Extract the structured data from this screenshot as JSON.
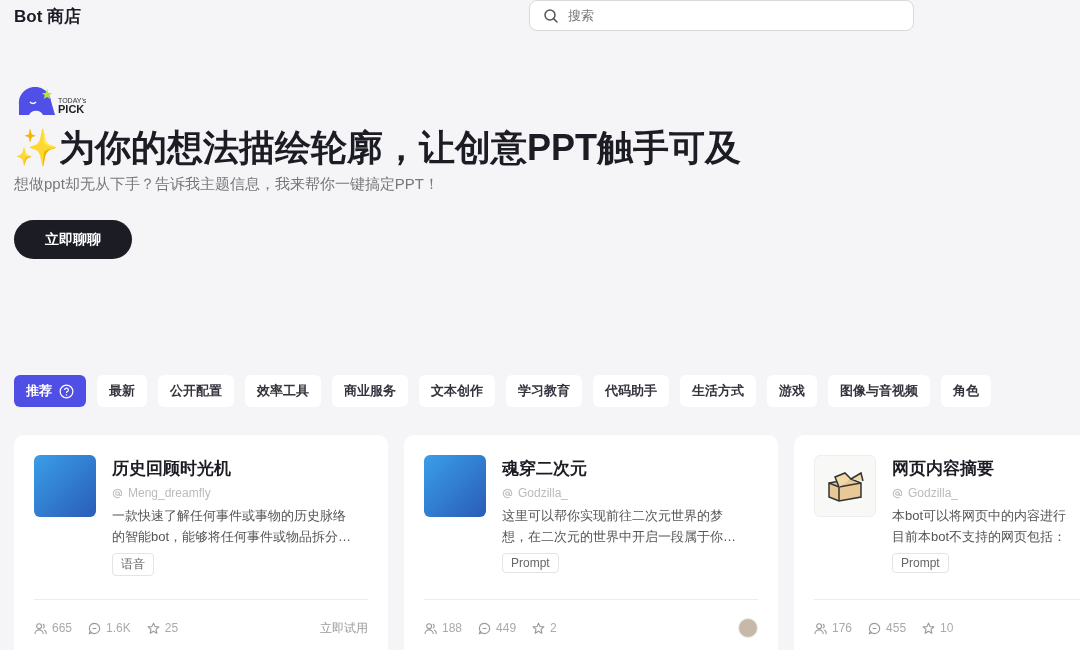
{
  "header": {
    "title": "Bot 商店",
    "search": {
      "placeholder": "搜索"
    }
  },
  "hero": {
    "badge_top": "TODAY's",
    "badge_bottom": "PICK",
    "emoji": "✨",
    "headline": "为你的想法描绘轮廓，让创意PPT触手可及",
    "subtitle": "想做ppt却无从下手？告诉我主题信息，我来帮你一键搞定PPT！",
    "button": "立即聊聊"
  },
  "categories": [
    {
      "label": "推荐",
      "selected": true,
      "help": true
    },
    {
      "label": "最新",
      "selected": false,
      "help": false
    },
    {
      "label": "公开配置",
      "selected": false,
      "help": false
    },
    {
      "label": "效率工具",
      "selected": false,
      "help": false
    },
    {
      "label": "商业服务",
      "selected": false,
      "help": false
    },
    {
      "label": "文本创作",
      "selected": false,
      "help": false
    },
    {
      "label": "学习教育",
      "selected": false,
      "help": false
    },
    {
      "label": "代码助手",
      "selected": false,
      "help": false
    },
    {
      "label": "生活方式",
      "selected": false,
      "help": false
    },
    {
      "label": "游戏",
      "selected": false,
      "help": false
    },
    {
      "label": "图像与音视频",
      "selected": false,
      "help": false
    },
    {
      "label": "角色",
      "selected": false,
      "help": false
    }
  ],
  "bots": [
    {
      "kind": "photo",
      "name": "历史回顾时光机",
      "author": "Meng_dreamfly",
      "description": [
        "一款快速了解任何事件或事物的历史脉络",
        "的智能bot，能够将任何事件或物品拆分…"
      ],
      "tag": "语音",
      "users": "665",
      "chats": "1.6K",
      "stars": "25",
      "action": "立即试用",
      "creator_avatar": false
    },
    {
      "kind": "photo",
      "name": "魂穿二次元",
      "author": "Godzilla_",
      "description": [
        "这里可以帮你实现前往二次元世界的梦",
        "想，在二次元的世界中开启一段属于你…"
      ],
      "tag": "Prompt",
      "users": "188",
      "chats": "449",
      "stars": "2",
      "creator_avatar": true
    },
    {
      "kind": "box",
      "name": "网页内容摘要",
      "author": "Godzilla_",
      "description": [
        "本bot可以将网页中的内容进行",
        "目前本bot不支持的网页包括："
      ],
      "tag": "Prompt",
      "users": "176",
      "chats": "455",
      "stars": "10",
      "creator_avatar": false
    }
  ]
}
